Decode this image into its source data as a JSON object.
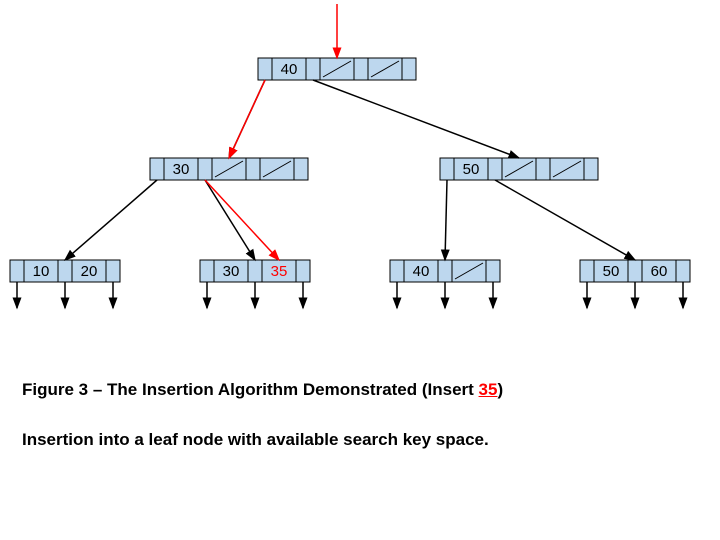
{
  "diagram": {
    "root": {
      "keys": [
        "40"
      ],
      "slots": 3
    },
    "left": {
      "keys": [
        "30"
      ],
      "slots": 3
    },
    "right": {
      "keys": [
        "50"
      ],
      "slots": 3
    },
    "leaf_a": {
      "keys": [
        "10",
        "20"
      ],
      "slots": 2
    },
    "leaf_b": {
      "keys": [
        "30",
        "35"
      ],
      "slots": 2,
      "inserted_index": 1
    },
    "leaf_c": {
      "keys": [
        "40"
      ],
      "slots": 2
    },
    "leaf_d": {
      "keys": [
        "50",
        "60"
      ],
      "slots": 2
    }
  },
  "caption": {
    "prefix": "Figure 3 – The Insertion Algorithm Demonstrated (Insert ",
    "value": "35",
    "suffix": ")"
  },
  "subcaption": "Insertion into a leaf node with available search key space.",
  "colors": {
    "node_fill": "#bdd7ee",
    "node_stroke": "#000",
    "ptr_arrow": "#000",
    "search_arrow": "#f00"
  }
}
